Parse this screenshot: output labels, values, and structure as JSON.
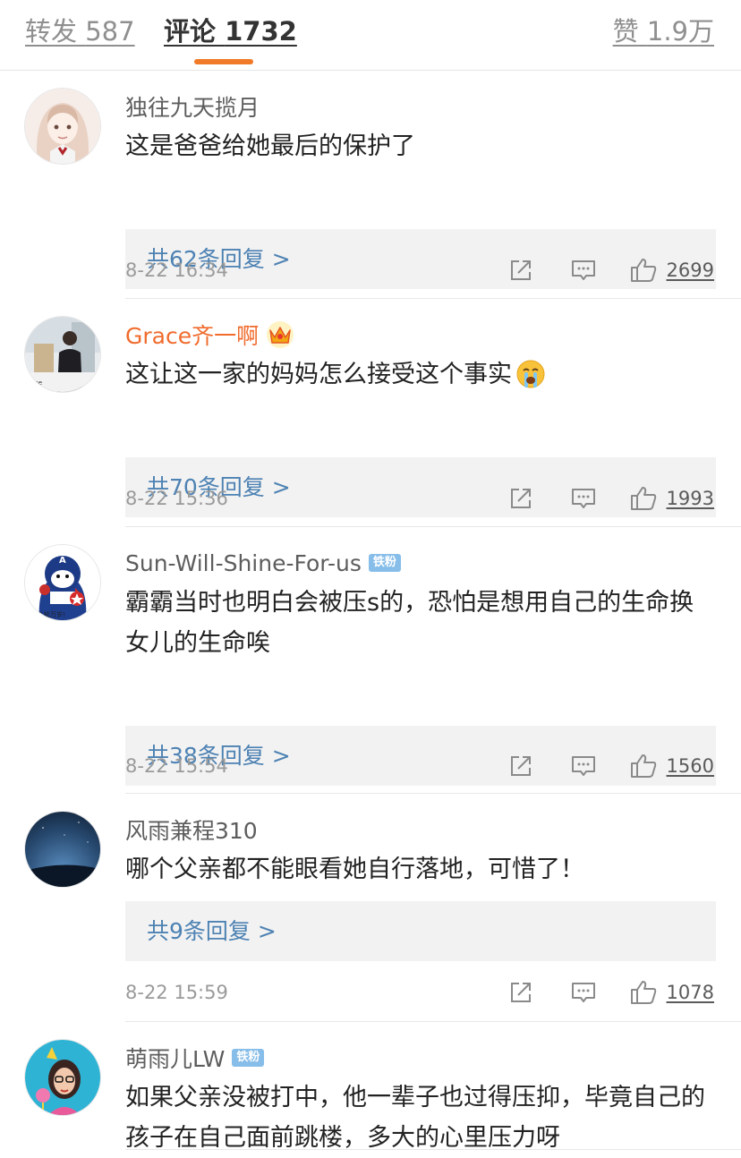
{
  "tabs": {
    "repost": {
      "label": "转发",
      "count": "587"
    },
    "comments": {
      "label": "评论",
      "count": "1732"
    },
    "likes": {
      "label": "赞",
      "count": "1.9万"
    }
  },
  "comments": [
    {
      "username": "独往九天揽月",
      "text": "这是爸爸给她最后的保护了",
      "replies": "共62条回复 >",
      "time": "8-22 16:34",
      "likes": "2699"
    },
    {
      "username": "Grace齐一啊",
      "text": "这让这一家的妈妈怎么接受这个事实",
      "replies": "共70条回复 >",
      "time": "8-22 15:36",
      "likes": "1993"
    },
    {
      "username": "Sun-Will-Shine-For-us",
      "badge": "铁粉",
      "text": "霸霸当时也明白会被压s的，恐怕是想用自己的生命换女儿的生命唉",
      "replies": "共38条回复 >",
      "time": "8-22 15:54",
      "likes": "1560"
    },
    {
      "username": "风雨兼程310",
      "text": "哪个父亲都不能眼看她自行落地，可惜了！",
      "replies": "共9条回复 >",
      "time": "8-22 15:59",
      "likes": "1078"
    },
    {
      "username": "萌雨儿LW",
      "badge": "铁粉",
      "text": "如果父亲没被打中，他一辈子也过得压抑，毕竟自己的孩子在自己面前跳楼，多大的心里压力呀"
    }
  ],
  "colors": {
    "accent": "#f07a28",
    "link": "#4d82b3",
    "vip_name": "#f06b2d",
    "badge": "#86bde9"
  }
}
